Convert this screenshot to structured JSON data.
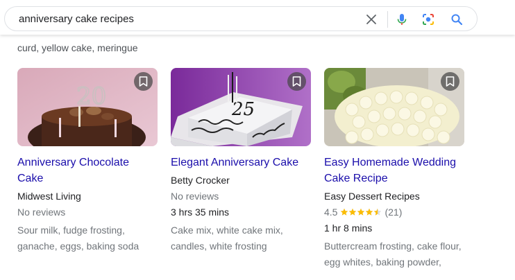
{
  "search": {
    "query": "anniversary cake recipes"
  },
  "previous_result": {
    "ingredients_tail": "curd, yellow cake, meringue"
  },
  "recipes": [
    {
      "title": "Anniversary Chocolate Cake",
      "source": "Midwest Living",
      "reviews": "No reviews",
      "ingredients": "Sour milk, fudge frosting, ganache, eggs, baking soda"
    },
    {
      "title": "Elegant Anniversary Cake",
      "source": "Betty Crocker",
      "reviews": "No reviews",
      "time": "3 hrs 35 mins",
      "ingredients": "Cake mix, white cake mix, candles, white frosting"
    },
    {
      "title": "Easy Homemade Wedding Cake Recipe",
      "source": "Easy Dessert Recipes",
      "rating": "4.5",
      "rating_value": 4.5,
      "review_count": "(21)",
      "time": "1 hr 8 mins",
      "ingredients": "Buttercream frosting, cake flour, egg whites, baking powder,"
    }
  ],
  "colors": {
    "link": "#1a0dab",
    "star": "#fbbc04",
    "muted": "#70757a"
  },
  "icons": [
    "clear-icon",
    "microphone-icon",
    "lens-camera-icon",
    "search-icon",
    "bookmark-icon",
    "star-icon"
  ]
}
